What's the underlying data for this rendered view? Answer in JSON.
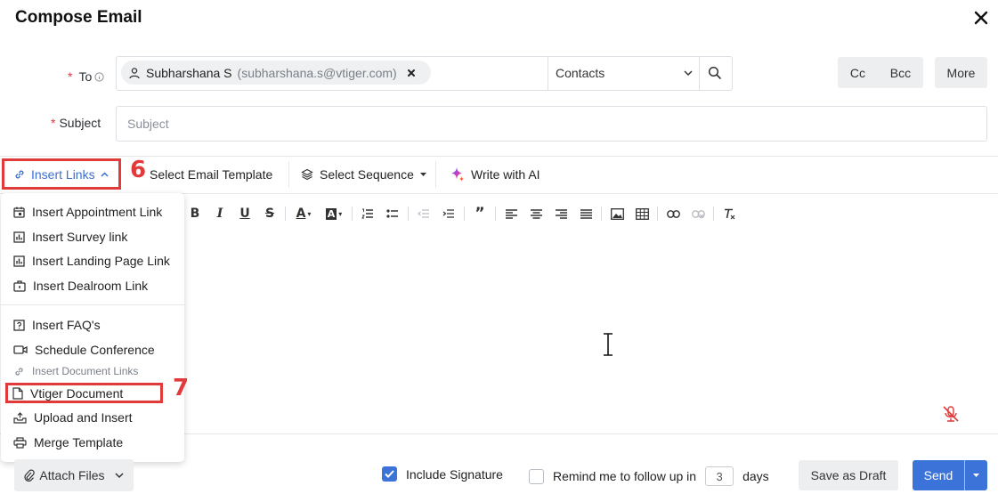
{
  "header": {
    "title": "Compose Email"
  },
  "to": {
    "label": "To",
    "recipient_name": "Subharshana S",
    "recipient_email": "(subharshana.s@vtiger.com)",
    "source_select": "Contacts",
    "cc_label": "Cc",
    "bcc_label": "Bcc",
    "more_label": "More"
  },
  "subject": {
    "label": "Subject",
    "placeholder": "Subject",
    "value": ""
  },
  "toolbar": {
    "insert_links": "Insert Links",
    "select_template": "Select Email Template",
    "select_sequence": "Select Sequence",
    "write_ai": "Write with AI"
  },
  "callouts": {
    "first": "6",
    "second": "7"
  },
  "dropdown": {
    "items": [
      {
        "label": "Insert Appointment Link",
        "icon": "calendar-icon"
      },
      {
        "label": "Insert Survey link",
        "icon": "chart-icon"
      },
      {
        "label": "Insert Landing Page Link",
        "icon": "chart-icon"
      },
      {
        "label": "Insert Dealroom Link",
        "icon": "briefcase-icon"
      },
      {
        "label": "Insert FAQ's",
        "icon": "question-icon"
      },
      {
        "label": "Schedule Conference",
        "icon": "video-icon"
      },
      {
        "label": "Insert Document Links",
        "icon": "link-icon"
      },
      {
        "label": "Vtiger Document",
        "icon": "document-icon"
      },
      {
        "label": "Upload and Insert",
        "icon": "upload-icon"
      },
      {
        "label": "Merge Template",
        "icon": "printer-icon"
      }
    ]
  },
  "footer": {
    "attach_files": "Attach Files",
    "include_signature": "Include Signature",
    "include_signature_checked": true,
    "remind_text": "Remind me to follow up in",
    "remind_checked": false,
    "remind_days": "3",
    "days_label": "days",
    "save_draft": "Save as Draft",
    "send": "Send"
  },
  "colors": {
    "accent": "#3b73d9",
    "highlight": "#e03a3a",
    "required": "#e0383e"
  }
}
